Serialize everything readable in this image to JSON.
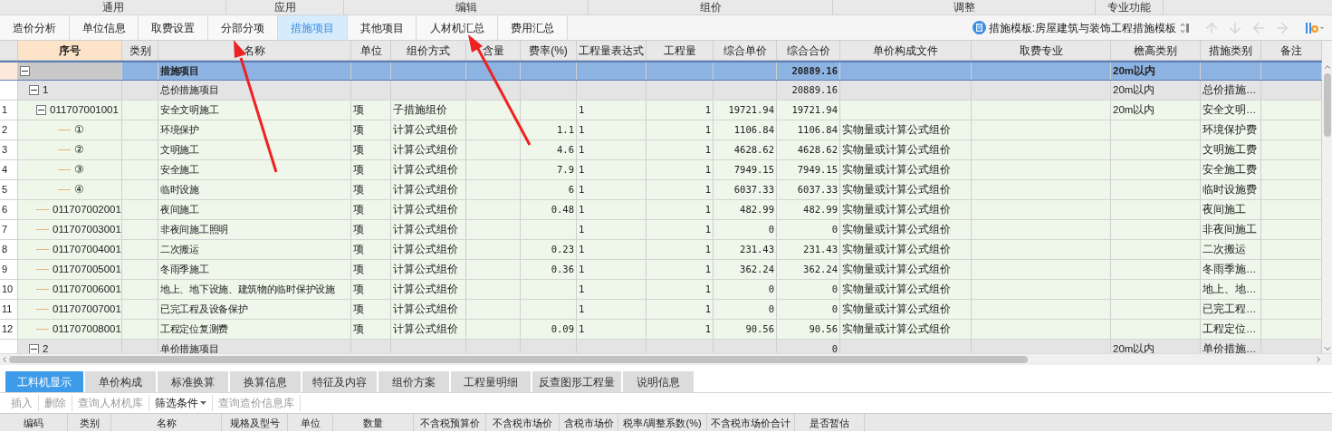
{
  "ribbon_groups": [
    "通用",
    "应用",
    "编辑",
    "组价",
    "调整",
    "专业功能"
  ],
  "tabs": [
    {
      "label": "造价分析",
      "selected": false
    },
    {
      "label": "单位信息",
      "selected": false
    },
    {
      "label": "取费设置",
      "selected": false
    },
    {
      "label": "分部分项",
      "selected": false
    },
    {
      "label": "措施项目",
      "selected": true
    },
    {
      "label": "其他项目",
      "selected": false
    },
    {
      "label": "人材机汇总",
      "selected": false
    },
    {
      "label": "费用汇总",
      "selected": false
    }
  ],
  "template": {
    "label": "措施模板:房屋建筑与装饰工程措施模板"
  },
  "nav_buttons": [
    {
      "kind": "up",
      "disabled": true
    },
    {
      "kind": "down",
      "disabled": true
    },
    {
      "kind": "left",
      "disabled": true
    },
    {
      "kind": "right",
      "disabled": true
    }
  ],
  "columns": [
    {
      "label": "序号",
      "selected": true
    },
    {
      "label": "类别",
      "selected": false
    },
    {
      "label": "名称",
      "selected": false
    },
    {
      "label": "单位",
      "selected": false
    },
    {
      "label": "组价方式",
      "selected": false
    },
    {
      "label": "含量",
      "selected": false
    },
    {
      "label": "费率(%)",
      "selected": false
    },
    {
      "label": "工程量表达式",
      "selected": false
    },
    {
      "label": "工程量",
      "selected": false
    },
    {
      "label": "综合单价",
      "selected": false
    },
    {
      "label": "综合合价",
      "selected": false
    },
    {
      "label": "单价构成文件",
      "selected": false
    },
    {
      "label": "取费专业",
      "selected": false
    },
    {
      "label": "檐高类别",
      "selected": false
    },
    {
      "label": "措施类别",
      "selected": false
    },
    {
      "label": "备注",
      "selected": false
    }
  ],
  "rows": [
    {
      "kind": "root",
      "selected": true,
      "expanded": true,
      "name": "措施项目",
      "total": "20889.16",
      "height_class": "20m以内",
      "children": [
        {
          "kind": "group",
          "selected": false,
          "expanded": true,
          "code": "1",
          "name": "总价措施项目",
          "total": "20889.16",
          "height_class": "20m以内",
          "measure_class": "总价措施…",
          "children": [
            {
              "kind": "item",
              "selected": false,
              "expanded": true,
              "row_number": "1",
              "code": "011707001001",
              "name": "安全文明施工",
              "unit": "项",
              "method": "子措施组价",
              "qty_expr": "1",
              "qty": "1",
              "unit_price": "19721.94",
              "total": "19721.94",
              "height_class": "20m以内",
              "measure_class": "安全文明…",
              "children": [
                {
                  "kind": "item",
                  "selected": false,
                  "row_number": "2",
                  "code": "①",
                  "name": "环境保护",
                  "unit": "项",
                  "method": "计算公式组价",
                  "rate": "1.1",
                  "qty_expr": "1",
                  "qty": "1",
                  "unit_price": "1106.84",
                  "total": "1106.84",
                  "price_file": "实物量或计算公式组价",
                  "measure_class": "环境保护费"
                },
                {
                  "kind": "item",
                  "selected": false,
                  "row_number": "3",
                  "code": "②",
                  "name": "文明施工",
                  "unit": "项",
                  "method": "计算公式组价",
                  "rate": "4.6",
                  "qty_expr": "1",
                  "qty": "1",
                  "unit_price": "4628.62",
                  "total": "4628.62",
                  "price_file": "实物量或计算公式组价",
                  "measure_class": "文明施工费"
                },
                {
                  "kind": "item",
                  "selected": false,
                  "row_number": "4",
                  "code": "③",
                  "name": "安全施工",
                  "unit": "项",
                  "method": "计算公式组价",
                  "rate": "7.9",
                  "qty_expr": "1",
                  "qty": "1",
                  "unit_price": "7949.15",
                  "total": "7949.15",
                  "price_file": "实物量或计算公式组价",
                  "measure_class": "安全施工费"
                },
                {
                  "kind": "item",
                  "selected": false,
                  "row_number": "5",
                  "code": "④",
                  "name": "临时设施",
                  "unit": "项",
                  "method": "计算公式组价",
                  "rate": "6",
                  "qty_expr": "1",
                  "qty": "1",
                  "unit_price": "6037.33",
                  "total": "6037.33",
                  "price_file": "实物量或计算公式组价",
                  "measure_class": "临时设施费"
                }
              ]
            },
            {
              "kind": "item",
              "selected": false,
              "row_number": "6",
              "code": "011707002001",
              "name": "夜间施工",
              "unit": "项",
              "method": "计算公式组价",
              "rate": "0.48",
              "qty_expr": "1",
              "qty": "1",
              "unit_price": "482.99",
              "total": "482.99",
              "price_file": "实物量或计算公式组价",
              "measure_class": "夜间施工"
            },
            {
              "kind": "item",
              "selected": false,
              "row_number": "7",
              "code": "011707003001",
              "name": "非夜间施工照明",
              "unit": "项",
              "method": "计算公式组价",
              "qty_expr": "1",
              "qty": "1",
              "unit_price": "0",
              "total": "0",
              "price_file": "实物量或计算公式组价",
              "measure_class": "非夜间施工"
            },
            {
              "kind": "item",
              "selected": false,
              "row_number": "8",
              "code": "011707004001",
              "name": "二次搬运",
              "unit": "项",
              "method": "计算公式组价",
              "rate": "0.23",
              "qty_expr": "1",
              "qty": "1",
              "unit_price": "231.43",
              "total": "231.43",
              "price_file": "实物量或计算公式组价",
              "measure_class": "二次搬运"
            },
            {
              "kind": "item",
              "selected": false,
              "row_number": "9",
              "code": "011707005001",
              "name": "冬雨季施工",
              "unit": "项",
              "method": "计算公式组价",
              "rate": "0.36",
              "qty_expr": "1",
              "qty": "1",
              "unit_price": "362.24",
              "total": "362.24",
              "price_file": "实物量或计算公式组价",
              "measure_class": "冬雨季施…"
            },
            {
              "kind": "item",
              "selected": false,
              "row_number": "10",
              "code": "011707006001",
              "name": "地上、地下设施、建筑物的临时保护设施",
              "unit": "项",
              "method": "计算公式组价",
              "qty_expr": "1",
              "qty": "1",
              "unit_price": "0",
              "total": "0",
              "price_file": "实物量或计算公式组价",
              "measure_class": "地上、地…"
            },
            {
              "kind": "item",
              "selected": false,
              "row_number": "11",
              "code": "011707007001",
              "name": "已完工程及设备保护",
              "unit": "项",
              "method": "计算公式组价",
              "qty_expr": "1",
              "qty": "1",
              "unit_price": "0",
              "total": "0",
              "price_file": "实物量或计算公式组价",
              "measure_class": "已完工程…"
            },
            {
              "kind": "item",
              "selected": false,
              "row_number": "12",
              "code": "011707008001",
              "name": "工程定位复测费",
              "unit": "项",
              "method": "计算公式组价",
              "rate": "0.09",
              "qty_expr": "1",
              "qty": "1",
              "unit_price": "90.56",
              "total": "90.56",
              "price_file": "实物量或计算公式组价",
              "measure_class": "工程定位…"
            }
          ]
        },
        {
          "kind": "group",
          "selected": false,
          "expanded": true,
          "code": "2",
          "name": "单价措施项目",
          "total": "0",
          "height_class": "20m以内",
          "measure_class": "单价措施…"
        }
      ]
    }
  ],
  "bottom_tabs": [
    {
      "label": "工料机显示",
      "selected": true
    },
    {
      "label": "单价构成",
      "selected": false
    },
    {
      "label": "标准换算",
      "selected": false
    },
    {
      "label": "换算信息",
      "selected": false
    },
    {
      "label": "特征及内容",
      "selected": false
    },
    {
      "label": "组价方案",
      "selected": false
    },
    {
      "label": "工程量明细",
      "selected": false
    },
    {
      "label": "反查图形工程量",
      "selected": false
    },
    {
      "label": "说明信息",
      "selected": false
    }
  ],
  "bottom_toolbar": [
    {
      "label": "插入",
      "disabled": true,
      "dropdown": false
    },
    {
      "label": "删除",
      "disabled": true,
      "dropdown": false
    },
    {
      "label": "查询人材机库",
      "disabled": true,
      "dropdown": false
    },
    {
      "label": "筛选条件",
      "disabled": false,
      "dropdown": true
    },
    {
      "label": "查询造价信息库",
      "disabled": true,
      "dropdown": false
    }
  ],
  "bottom_columns": [
    "编码",
    "类别",
    "名称",
    "规格及型号",
    "单位",
    "数量",
    "不含税预算价",
    "不含税市场价",
    "含税市场价",
    "税率/调整系数(%)",
    "不含税市场价合计",
    "是否暂估"
  ]
}
